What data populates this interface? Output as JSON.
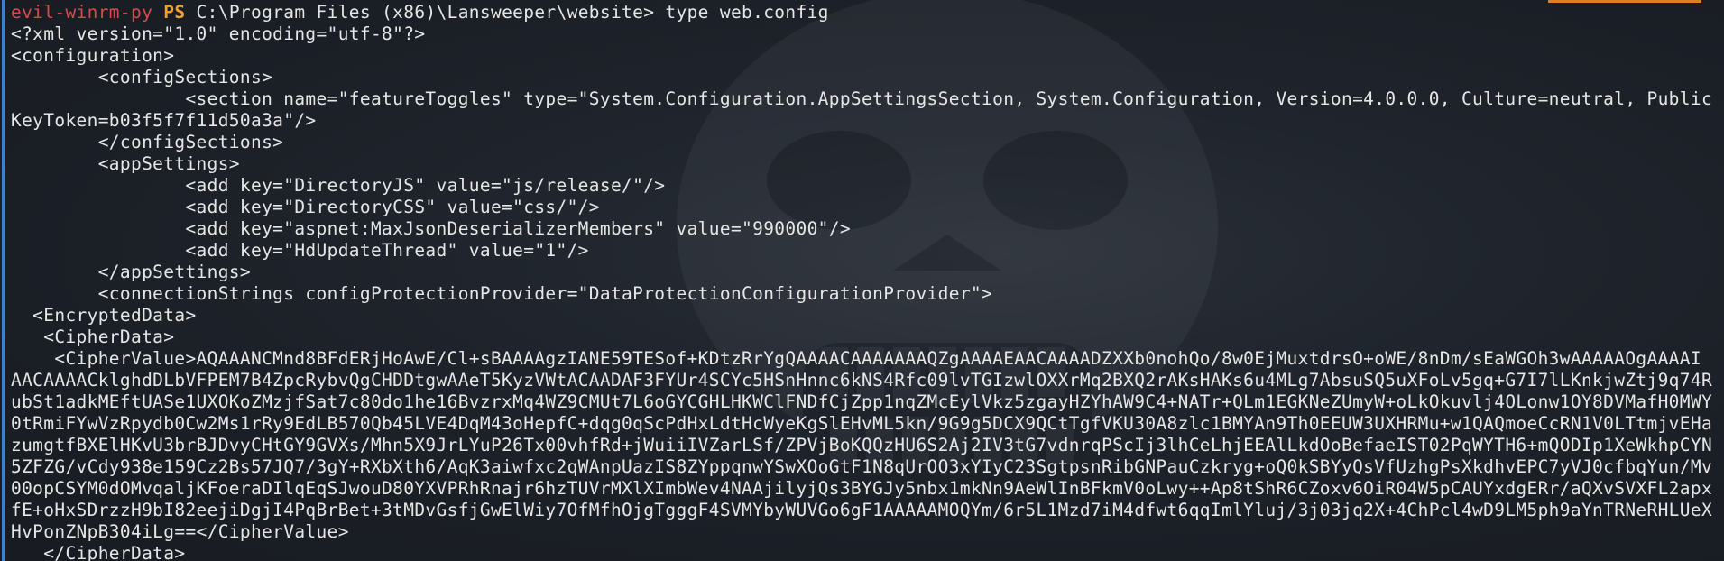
{
  "prompt": {
    "name": "evil-winrm-py",
    "ps": "PS",
    "command": " C:\\Program Files (x86)\\Lansweeper\\website> type web.config"
  },
  "output_lines": [
    "<?xml version=\"1.0\" encoding=\"utf-8\"?>",
    "<configuration>",
    "        <configSections>",
    "                <section name=\"featureToggles\" type=\"System.Configuration.AppSettingsSection, System.Configuration, Version=4.0.0.0, Culture=neutral, Public",
    "KeyToken=b03f5f7f11d50a3a\"/>",
    "        </configSections>",
    "        <appSettings>",
    "                <add key=\"DirectoryJS\" value=\"js/release/\"/>",
    "                <add key=\"DirectoryCSS\" value=\"css/\"/>",
    "                <add key=\"aspnet:MaxJsonDeserializerMembers\" value=\"990000\"/>",
    "                <add key=\"HdUpdateThread\" value=\"1\"/>",
    "        </appSettings>",
    "        <connectionStrings configProtectionProvider=\"DataProtectionConfigurationProvider\">",
    "  <EncryptedData>",
    "   <CipherData>",
    "    <CipherValue>AQAAANCMnd8BFdERjHoAwE/Cl+sBAAAAgzIANE59TESof+KDtzRrYgQAAAACAAAAAAAQZgAAAAEAACAAAADZXXb0nohQo/8w0EjMuxtdrsO+oWE/8nDm/sEaWGOh3wAAAAAOgAAAAI",
    "AACAAAACklghdDLbVFPEM7B4ZpcRybvQgCHDDtgwAAeT5KyzVWtACAADAF3FYUr4SCYc5HSnHnnc6kNS4Rfc09lvTGIzwlOXXrMq2BXQ2rAKsHAKs6u4MLg7AbsuSQ5uXFoLv5gq+G7I7lLKnkjwZtj9q74R",
    "ubSt1adkMEftUASe1UXOKoZMzjfSat7c80do1he16BvzrxMq4WZ9CMUt7L6oGYCGHLHKWClFNDfCjZpp1nqZMcEylVkz5zgayHZYhAW9C4+NATr+QLm1EGKNeZUmyW+oLkOkuvlj4OLonw1OY8DVMafH0MWY",
    "0tRmiFYwVzRpydb0Cw2Ms1rRy9EdLB570Qb45LVE4DqM43oHepfC+dqg0qScPdHxLdtHcWyeKgSlEHvML5kn/9G9g5DCX9QCtTgfVKU30A8zlc1BMYAn9Th0EEUW3UXHRMu+w1QAQmoeCcRN1V0LTtmjvEHa",
    "zumgtfBXElHKvU3brBJDvyCHtGY9GVXs/Mhn5X9JrLYuP26Tx00vhfRd+jWuiiIVZarLSf/ZPVjBoKQQzHU6S2Aj2IV3tG7vdnrqPScIj3lhCeLhjEEAlLkdOoBefaeIST02PqWYTH6+mQODIp1XeWkhpCYN",
    "5ZFZG/vCdy938e159Cz2Bs57JQ7/3gY+RXbXth6/AqK3aiwfxc2qWAnpUazIS8ZYppqnwYSwXOoGtF1N8qUrOO3xYIyC23SgtpsnRibGNPauCzkryg+oQ0kSBYyQsVfUzhgPsXkdhvEPC7yVJ0cfbqYun/Mv",
    "00opCSYM0dOMvqaljKFoeraDIlqEqSJwouD80YXVPRhRnajr6hzTUVrMXlXImbWev4NAAjilyjQs3BYGJy5nbx1mkNn9AeWlInBFkmV0oLwy++Ap8tShR6CZoxv6OiR04W5pCAUYxdgERr/aQXvSVXFL2apx",
    "fE+oHxSDrzzH9bI82eejiDgjI4PqBrBet+3tMDvGsfjGwElWiy7OfMfhOjgTgggF4SVMYbyWUVGo6gF1AAAAAMOQYm/6r5L1Mzd7iM4dfwt6qqImlYluj/3j03jq2X+4ChPcl4wD9LM5ph9aYnTRNeRHLUeX",
    "HvPonZNpB304iLg==</CipherValue>",
    "   </CipherData>"
  ],
  "colors": {
    "prompt_name": "#d94a4a",
    "prompt_ps": "#f0a030",
    "text": "#e6e6e6",
    "background": "#1c2129",
    "accent_border": "#3f7fd0",
    "tab_accent": "#d9822b"
  }
}
